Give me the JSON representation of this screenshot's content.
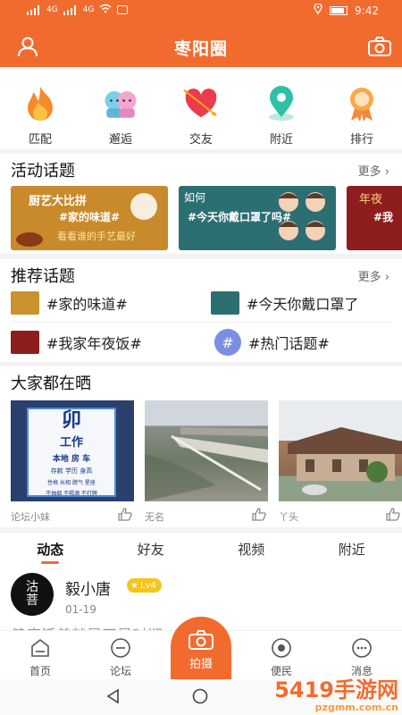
{
  "status": {
    "time": "9:42",
    "net1": "4G",
    "net2": "4G"
  },
  "header": {
    "title": "枣阳圈",
    "left_icon": "user-icon",
    "right_icon": "camera-icon"
  },
  "quick": [
    {
      "label": "匹配",
      "icon": "flame-icon"
    },
    {
      "label": "邂逅",
      "icon": "couple-icon"
    },
    {
      "label": "交友",
      "icon": "heart-arrow-icon"
    },
    {
      "label": "附近",
      "icon": "location-pin-icon"
    },
    {
      "label": "排行",
      "icon": "medal-icon"
    }
  ],
  "activity": {
    "title": "活动话题",
    "more": "更多",
    "banners": [
      {
        "tag": "#家的味道#",
        "headline": "厨艺大比拼",
        "sub": "看看谁的手艺最好"
      },
      {
        "tag": "#今天你戴口罩了吗#",
        "headline": "如何"
      },
      {
        "tag": "#我",
        "headline": "年夜"
      }
    ]
  },
  "recommend": {
    "title": "推荐话题",
    "more": "更多",
    "items": [
      {
        "text": "#家的味道#"
      },
      {
        "text": "#今天你戴口罩了"
      },
      {
        "text": "#我家年夜饭#"
      },
      {
        "text": "#热门话题#",
        "badge": "#"
      }
    ]
  },
  "photos": {
    "title": "大家都在晒",
    "items": [
      {
        "name": "论坛小妹",
        "sign": [
          "卯",
          "工作",
          "本地 房 车",
          "存款 学历 身高",
          "性格 长相 脾气 星座",
          "不抽烟 不喝酒 不打牌"
        ]
      },
      {
        "name": "无名"
      },
      {
        "name": "丫头"
      }
    ]
  },
  "tabs": [
    {
      "label": "动态",
      "active": true
    },
    {
      "label": "好友"
    },
    {
      "label": "视频"
    },
    {
      "label": "附近"
    }
  ],
  "post": {
    "user": "毅小唐",
    "level": "Lv4",
    "date": "01-19",
    "avatar_text": "沽\n菩",
    "teaser": "健康活着就是天是时期"
  },
  "bottom_nav": [
    {
      "label": "首页",
      "icon": "home-icon"
    },
    {
      "label": "论坛",
      "icon": "forum-icon"
    },
    {
      "label": "拍摄",
      "icon": "camera-icon"
    },
    {
      "label": "便民",
      "icon": "service-icon"
    },
    {
      "label": "消息",
      "icon": "message-icon"
    }
  ],
  "watermark": {
    "brand": "5419手游网",
    "url": "pzgmm.com.cn"
  },
  "colors": {
    "accent": "#f26b2e",
    "level_badge": "#f5c518"
  }
}
